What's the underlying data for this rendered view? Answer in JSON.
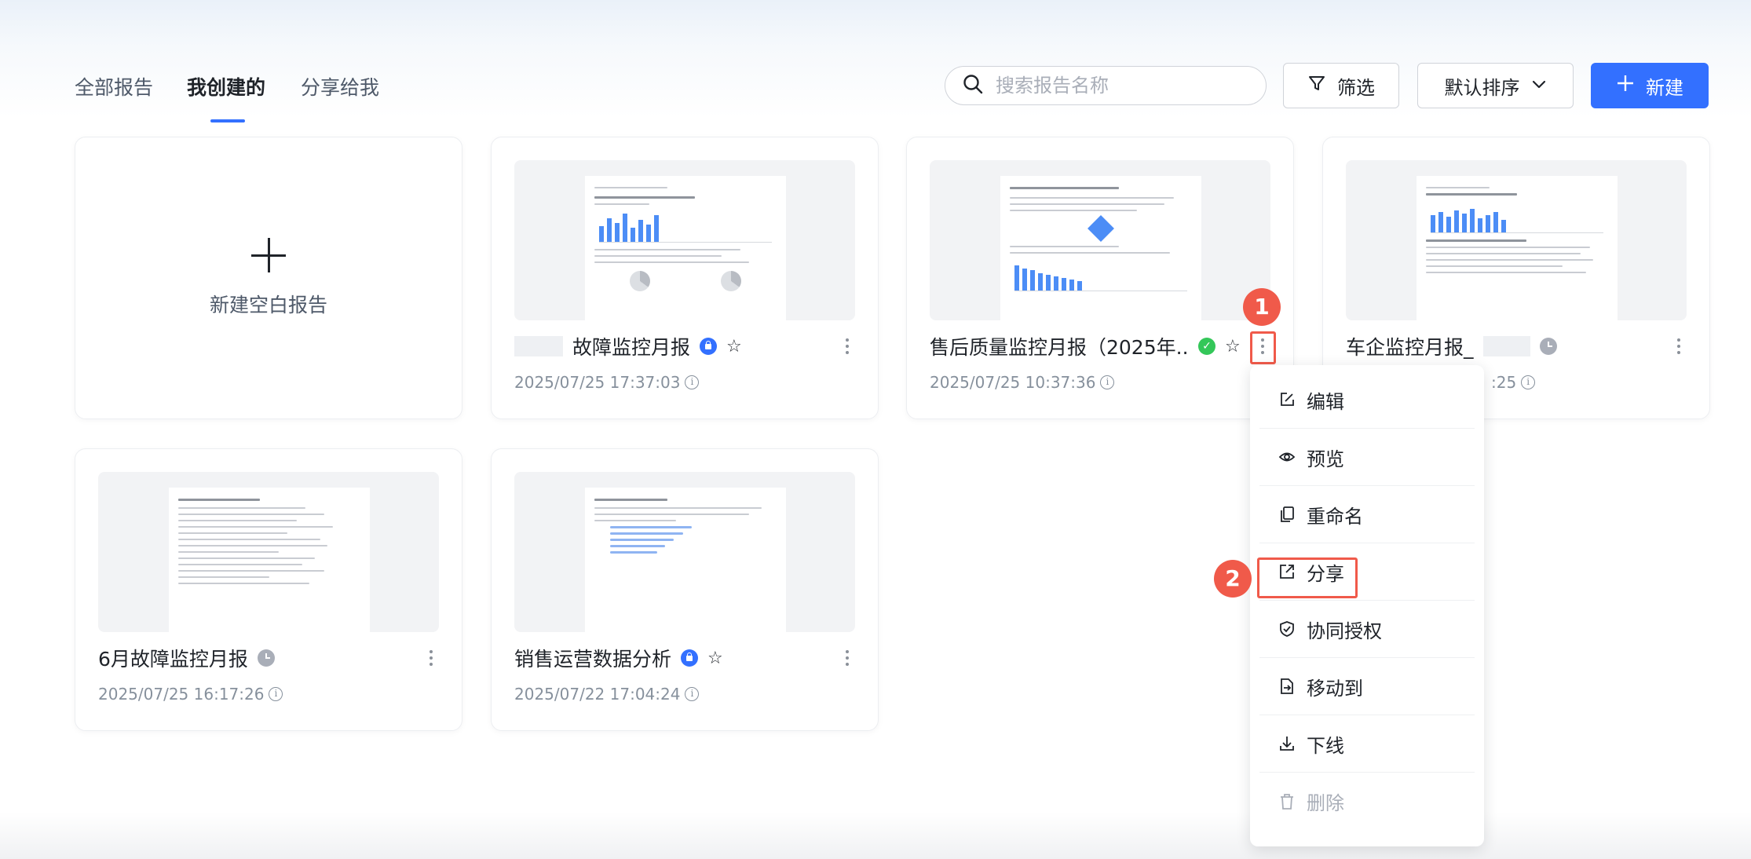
{
  "tabs": [
    {
      "label": "全部报告"
    },
    {
      "label": "我创建的"
    },
    {
      "label": "分享给我"
    }
  ],
  "toolbar": {
    "search_placeholder": "搜索报告名称",
    "filter_label": "筛选",
    "sort_label": "默认排序",
    "new_label": "新建"
  },
  "new_blank": {
    "label": "新建空白报告"
  },
  "reports": [
    {
      "title": "故障监控月报",
      "date": "2025/07/25 17:37:03",
      "badge": "lock-icon",
      "starred": false
    },
    {
      "title": "售后质量监控月报（2025年...",
      "date": "2025/07/25 10:37:36",
      "badge": "check-icon",
      "starred": false
    },
    {
      "title": "车企监控月报_",
      "date": ":25",
      "badge": "clock-icon",
      "starred": false
    },
    {
      "title": "6月故障监控月报",
      "date": "2025/07/25 16:17:26",
      "badge": "clock-icon",
      "starred": false
    },
    {
      "title": "销售运营数据分析",
      "date": "2025/07/22 17:04:24",
      "badge": "lock-icon",
      "starred": false
    }
  ],
  "menu": {
    "items": [
      {
        "label": "编辑",
        "icon": "edit-icon"
      },
      {
        "label": "预览",
        "icon": "eye-icon"
      },
      {
        "label": "重命名",
        "icon": "rename-icon"
      },
      {
        "label": "分享",
        "icon": "share-icon"
      },
      {
        "label": "协同授权",
        "icon": "shield-icon"
      },
      {
        "label": "移动到",
        "icon": "move-icon"
      },
      {
        "label": "下线",
        "icon": "download-icon"
      },
      {
        "label": "删除",
        "icon": "trash-icon",
        "disabled": true
      }
    ]
  },
  "annotations": {
    "step1": "1",
    "step2": "2"
  },
  "colors": {
    "accent": "#3370ff",
    "annotation": "#f05a4a",
    "success": "#34c759"
  }
}
